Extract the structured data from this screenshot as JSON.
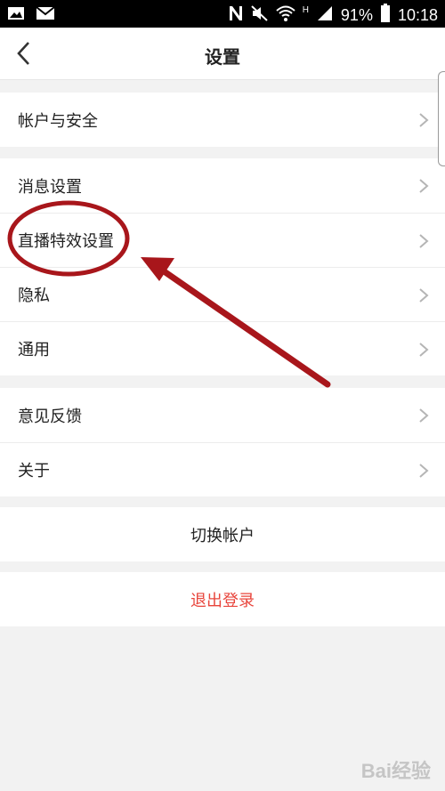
{
  "status_bar": {
    "battery_text": "91%",
    "time": "10:18",
    "network_type": "H",
    "icons": [
      "photo-icon",
      "mail-icon",
      "nfc-icon",
      "mute-icon",
      "wifi-icon",
      "signal-icon",
      "battery-icon"
    ]
  },
  "header": {
    "title": "设置",
    "back_icon": "chevron-left-icon"
  },
  "groups": [
    {
      "items": [
        {
          "label": "帐户与安全"
        }
      ]
    },
    {
      "items": [
        {
          "label": "消息设置"
        },
        {
          "label": "直播特效设置"
        },
        {
          "label": "隐私"
        },
        {
          "label": "通用"
        }
      ]
    },
    {
      "items": [
        {
          "label": "意见反馈"
        },
        {
          "label": "关于"
        }
      ]
    }
  ],
  "switch_account": {
    "label": "切换帐户"
  },
  "logout": {
    "label": "退出登录",
    "color": "#e8453c"
  },
  "annotation": {
    "color": "#a8161b"
  },
  "watermark": {
    "text": "Bai经验"
  }
}
